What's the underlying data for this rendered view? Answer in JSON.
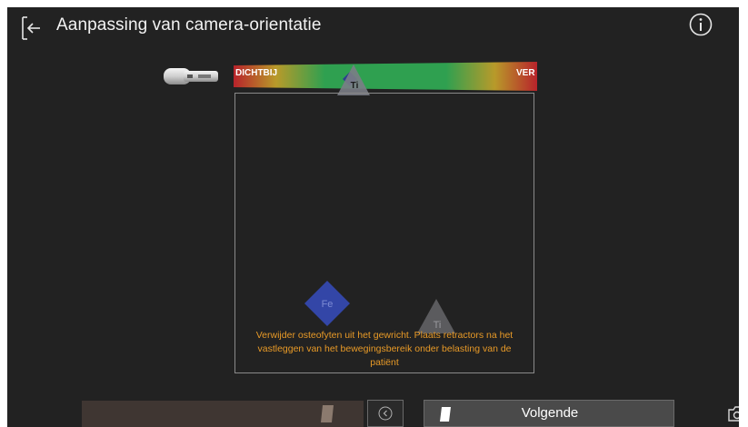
{
  "header": {
    "title": "Aanpassing van camera-orientatie",
    "back_icon": "arrow-left-icon",
    "info_icon": "info-icon"
  },
  "distance_indicator": {
    "near_label": "DICHTBIJ",
    "far_label": "VER",
    "marker_label": "Ti",
    "camera_icon": "camera-tracker-icon",
    "colors": {
      "near": "#b8232b",
      "mid": "#2fa050",
      "far": "#b8232b"
    }
  },
  "view": {
    "femur_marker_label": "Fe",
    "tibia_marker_label": "Ti",
    "instruction": "Verwijder osteofyten uit het gewricht. Plaats retractors na het vastleggen van het bewegingsbereik onder belasting van de patiënt"
  },
  "footer": {
    "next_label": "Volgende",
    "prev_icon": "chevron-left-circle-icon",
    "next_icon": "card-icon",
    "capture_icon": "camera-icon"
  }
}
